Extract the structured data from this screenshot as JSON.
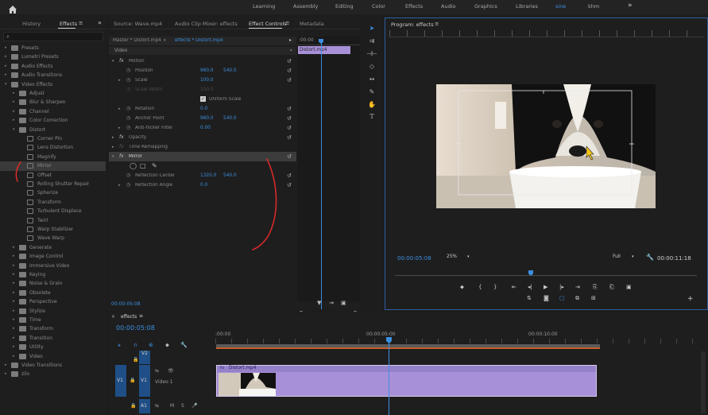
{
  "topbar": {
    "workspaces": [
      "Learning",
      "Assembly",
      "Editing",
      "Color",
      "Effects",
      "Audio",
      "Graphics",
      "Libraries",
      "sine",
      "khm"
    ],
    "more": "»"
  },
  "left_panel": {
    "tabs": [
      "History",
      "Effects"
    ],
    "tab_menu": "≡",
    "more": "»",
    "search_placeholder": "",
    "tree": [
      {
        "label": "Presets",
        "indent": 0,
        "type": "folder",
        "expanded": false
      },
      {
        "label": "Lumetri Presets",
        "indent": 0,
        "type": "folder",
        "expanded": false
      },
      {
        "label": "Audio Effects",
        "indent": 0,
        "type": "folder",
        "expanded": false
      },
      {
        "label": "Audio Transitions",
        "indent": 0,
        "type": "folder",
        "expanded": false
      },
      {
        "label": "Video Effects",
        "indent": 0,
        "type": "folder",
        "expanded": true
      },
      {
        "label": "Adjust",
        "indent": 1,
        "type": "folder",
        "expanded": false
      },
      {
        "label": "Blur & Sharpen",
        "indent": 1,
        "type": "folder",
        "expanded": false
      },
      {
        "label": "Channel",
        "indent": 1,
        "type": "folder",
        "expanded": false
      },
      {
        "label": "Color Correction",
        "indent": 1,
        "type": "folder",
        "expanded": false
      },
      {
        "label": "Distort",
        "indent": 1,
        "type": "folder",
        "expanded": true
      },
      {
        "label": "Corner Pin",
        "indent": 2,
        "type": "fx"
      },
      {
        "label": "Lens Distortion",
        "indent": 2,
        "type": "fx"
      },
      {
        "label": "Magnify",
        "indent": 2,
        "type": "fx"
      },
      {
        "label": "Mirror",
        "indent": 2,
        "type": "fx",
        "selected": true
      },
      {
        "label": "Offset",
        "indent": 2,
        "type": "fx"
      },
      {
        "label": "Rolling Shutter Repair",
        "indent": 2,
        "type": "fx"
      },
      {
        "label": "Spherize",
        "indent": 2,
        "type": "fx"
      },
      {
        "label": "Transform",
        "indent": 2,
        "type": "fx"
      },
      {
        "label": "Turbulent Displace",
        "indent": 2,
        "type": "fx"
      },
      {
        "label": "Twirl",
        "indent": 2,
        "type": "fx"
      },
      {
        "label": "Warp Stabilizer",
        "indent": 2,
        "type": "fx"
      },
      {
        "label": "Wave Warp",
        "indent": 2,
        "type": "fx"
      },
      {
        "label": "Generate",
        "indent": 1,
        "type": "folder",
        "expanded": false
      },
      {
        "label": "Image Control",
        "indent": 1,
        "type": "folder",
        "expanded": false
      },
      {
        "label": "Immersive Video",
        "indent": 1,
        "type": "folder",
        "expanded": false
      },
      {
        "label": "Keying",
        "indent": 1,
        "type": "folder",
        "expanded": false
      },
      {
        "label": "Noise & Grain",
        "indent": 1,
        "type": "folder",
        "expanded": false
      },
      {
        "label": "Obsolete",
        "indent": 1,
        "type": "folder",
        "expanded": false
      },
      {
        "label": "Perspective",
        "indent": 1,
        "type": "folder",
        "expanded": false
      },
      {
        "label": "Stylize",
        "indent": 1,
        "type": "folder",
        "expanded": false
      },
      {
        "label": "Time",
        "indent": 1,
        "type": "folder",
        "expanded": false
      },
      {
        "label": "Transform",
        "indent": 1,
        "type": "folder",
        "expanded": false
      },
      {
        "label": "Transition",
        "indent": 1,
        "type": "folder",
        "expanded": false
      },
      {
        "label": "Utility",
        "indent": 1,
        "type": "folder",
        "expanded": false
      },
      {
        "label": "Video",
        "indent": 1,
        "type": "folder",
        "expanded": false
      },
      {
        "label": "Video Transitions",
        "indent": 0,
        "type": "folder",
        "expanded": false
      },
      {
        "label": "zilo",
        "indent": 0,
        "type": "folder",
        "expanded": false
      }
    ]
  },
  "effect_controls": {
    "tabs": [
      "Source: Wave.mp4",
      "Audio Clip Mixer: effects",
      "Effect Controls",
      "Metadata"
    ],
    "active_tab": "Effect Controls",
    "tab_menu": "≡",
    "master_label": "Master * Distort.mp4",
    "clip_label": "effects * Distort.mp4",
    "ruler_time": ":00:00",
    "clip_bar_label": "Distort.mp4",
    "section": "Video",
    "rows": [
      {
        "kind": "effect",
        "label": "Motion",
        "expanded": true
      },
      {
        "kind": "prop",
        "label": "Position",
        "v1": "960.0",
        "v2": "540.0",
        "stopwatch": true
      },
      {
        "kind": "prop",
        "label": "Scale",
        "v1": "100.0",
        "arrow": true,
        "stopwatch": true
      },
      {
        "kind": "prop",
        "label": "Scale Width",
        "v1": "100.0",
        "dim": true,
        "stopwatch": true
      },
      {
        "kind": "check",
        "label": "Uniform Scale"
      },
      {
        "kind": "prop",
        "label": "Rotation",
        "v1": "0.0",
        "arrow": true,
        "stopwatch": true
      },
      {
        "kind": "prop",
        "label": "Anchor Point",
        "v1": "960.0",
        "v2": "540.0",
        "stopwatch": true
      },
      {
        "kind": "prop",
        "label": "Anti-flicker Filter",
        "v1": "0.00",
        "arrow": true,
        "stopwatch": true
      },
      {
        "kind": "effect",
        "label": "Opacity",
        "expanded": false
      },
      {
        "kind": "effect",
        "label": "Time Remapping",
        "expanded": false,
        "dimfx": true
      },
      {
        "kind": "effect",
        "label": "Mirror",
        "expanded": true,
        "selected": true
      },
      {
        "kind": "masks"
      },
      {
        "kind": "prop",
        "label": "Reflection Center",
        "v1": "1320.0",
        "v2": "540.0",
        "stopwatch": true
      },
      {
        "kind": "prop",
        "label": "Reflection Angle",
        "v1": "0.0",
        "arrow": true,
        "stopwatch": true
      }
    ],
    "timecode": "00:00:05:08"
  },
  "program": {
    "title": "Program: effects",
    "tab_menu": "≡",
    "timecode": "00:00:05:08",
    "zoom": "25%",
    "quality": "Full",
    "duration": "00:00:11:18",
    "playhead_fraction": 0.45
  },
  "timeline": {
    "sequence_name": "effects",
    "tab_menu": "≡",
    "close": "×",
    "timecode": "00:00:05:08",
    "ruler_labels": [
      ":00:00",
      "00:00:05:00",
      "00:00:10:00"
    ],
    "tracks": [
      {
        "name": "V2",
        "target": ""
      },
      {
        "name": "V1",
        "target": "V1",
        "label": "Video 1"
      },
      {
        "name": "A1",
        "target": "A1"
      }
    ],
    "clip_label": "Distort.mp4",
    "fx_badge": "fx",
    "track_controls": {
      "lock": "🔒",
      "sync": "⇆",
      "eye": "👁",
      "mute": "M",
      "solo": "S",
      "mic": "🎤"
    }
  },
  "colors": {
    "accent_blue": "#3b8fe0",
    "clip_purple": "#a890d8",
    "selection_outline": "#2d5f9e",
    "annotation_red": "#d42a2a"
  }
}
